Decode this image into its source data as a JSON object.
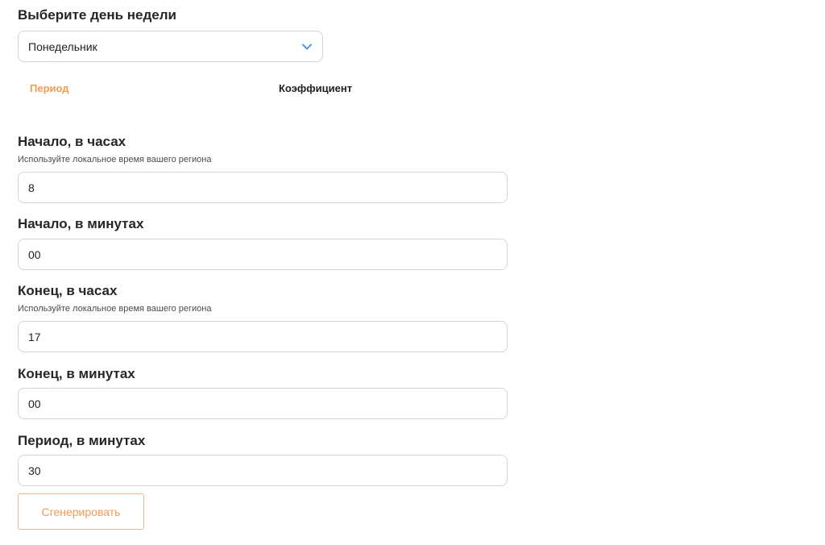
{
  "day_select": {
    "heading": "Выберите день недели",
    "value": "Понедельник",
    "chevron_icon": "chevron-down-icon",
    "chevron_color": "#3b8ee6"
  },
  "tabs": [
    {
      "label": "Период",
      "active": true
    },
    {
      "label": "Коэффициент",
      "active": false
    }
  ],
  "colors": {
    "accent": "#f29b53",
    "border": "#d4d4d4",
    "text": "#262626"
  },
  "fields": [
    {
      "label": "Начало, в часах",
      "hint": "Используйте локальное время вашего региона",
      "value": "8"
    },
    {
      "label": "Начало, в минутах",
      "value": "00"
    },
    {
      "label": "Конец, в часах",
      "hint": "Используйте локальное время вашего региона",
      "value": "17"
    },
    {
      "label": "Конец, в минутах",
      "value": "00"
    },
    {
      "label": "Период, в минутах",
      "value": "30"
    }
  ],
  "actions": {
    "generate_label": "Сгенерировать"
  }
}
